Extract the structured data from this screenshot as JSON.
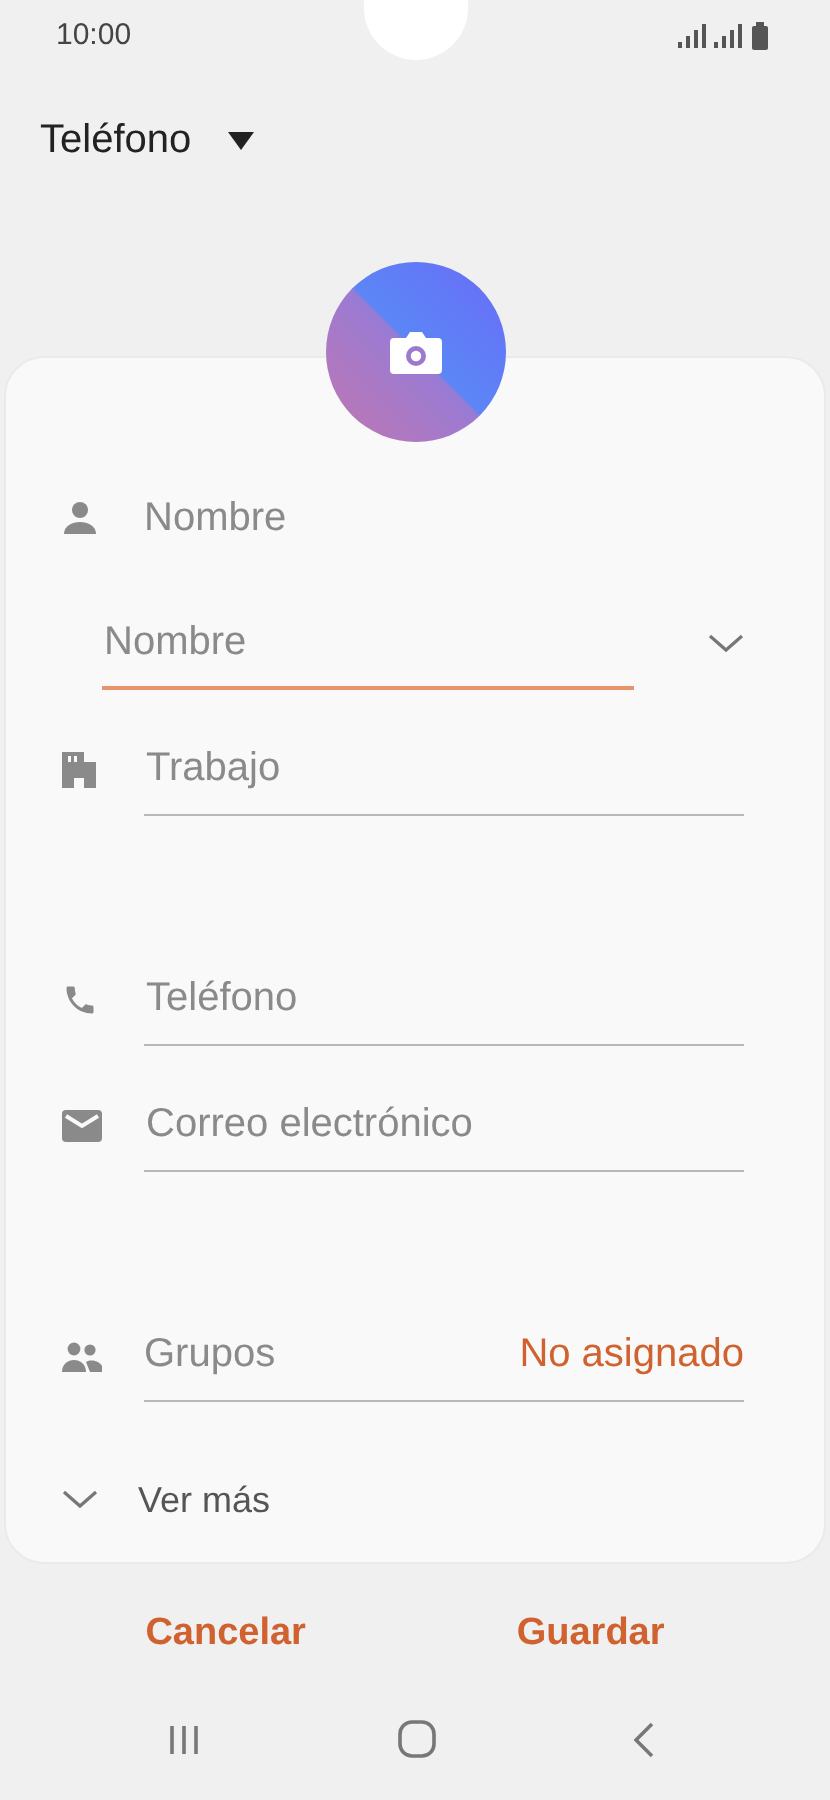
{
  "status_bar": {
    "time": "10:00"
  },
  "storage": {
    "label": "Teléfono"
  },
  "sections": [
    [
      {
        "kind": "header",
        "label": "Nombre"
      },
      {
        "kind": "input",
        "placeholder": "Nombre",
        "focused": true,
        "expandable": true
      },
      {
        "kind": "input",
        "placeholder": "Trabajo",
        "focused": false,
        "expandable": false
      }
    ],
    [
      {
        "kind": "input",
        "placeholder": "Teléfono",
        "focused": false,
        "expandable": false
      },
      {
        "kind": "input",
        "placeholder": "Correo electrónico",
        "focused": false,
        "expandable": false
      }
    ],
    [
      {
        "kind": "select",
        "label": "Grupos",
        "value": "No asignado"
      }
    ]
  ],
  "more": {
    "label": "Ver más"
  },
  "buttons": [
    "Cancelar",
    "Guardar"
  ]
}
